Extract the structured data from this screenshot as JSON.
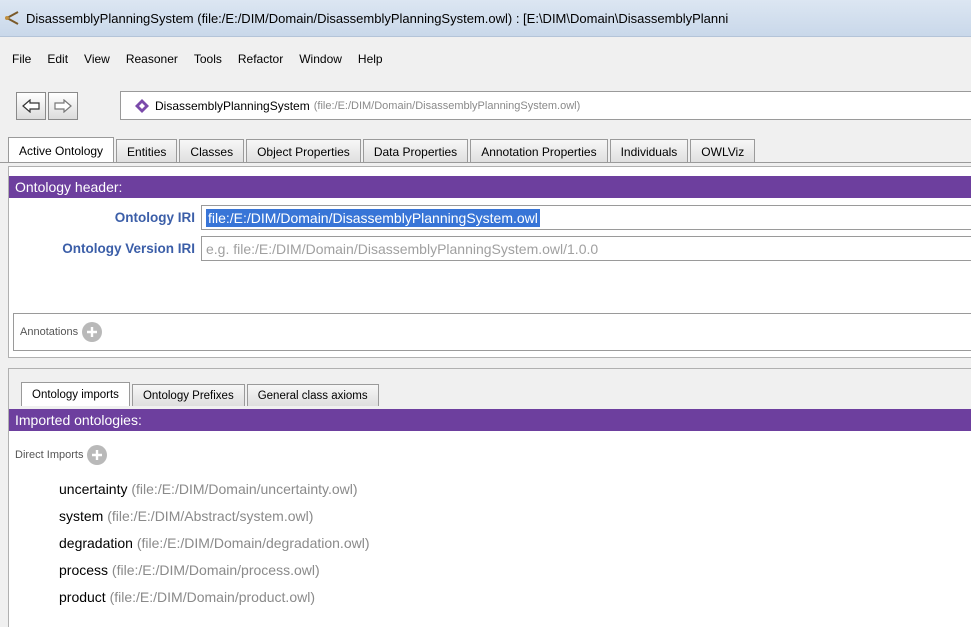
{
  "window": {
    "title": "DisassemblyPlanningSystem (file:/E:/DIM/Domain/DisassemblyPlanningSystem.owl)  : [E:\\DIM\\Domain\\DisassemblyPlanni"
  },
  "menu": [
    "File",
    "Edit",
    "View",
    "Reasoner",
    "Tools",
    "Refactor",
    "Window",
    "Help"
  ],
  "address": {
    "name": "DisassemblyPlanningSystem",
    "path": "(file:/E:/DIM/Domain/DisassemblyPlanningSystem.owl)"
  },
  "tabs": [
    "Active Ontology",
    "Entities",
    "Classes",
    "Object Properties",
    "Data Properties",
    "Annotation Properties",
    "Individuals",
    "OWLViz"
  ],
  "header": {
    "title": "Ontology header:",
    "iri_label": "Ontology IRI",
    "iri_value": "file:/E:/DIM/Domain/DisassemblyPlanningSystem.owl",
    "version_label": "Ontology Version IRI",
    "version_placeholder": "e.g. file:/E:/DIM/Domain/DisassemblyPlanningSystem.owl/1.0.0",
    "annotations_label": "Annotations"
  },
  "subtabs": [
    "Ontology imports",
    "Ontology Prefixes",
    "General class axioms"
  ],
  "imports": {
    "title": "Imported ontologies:",
    "direct_label": "Direct Imports",
    "items": [
      {
        "name": "uncertainty",
        "path": "(file:/E:/DIM/Domain/uncertainty.owl)"
      },
      {
        "name": "system",
        "path": "(file:/E:/DIM/Abstract/system.owl)"
      },
      {
        "name": "degradation",
        "path": "(file:/E:/DIM/Domain/degradation.owl)"
      },
      {
        "name": "process",
        "path": "(file:/E:/DIM/Domain/process.owl)"
      },
      {
        "name": "product",
        "path": "(file:/E:/DIM/Domain/product.owl)"
      }
    ]
  },
  "colors": {
    "accent": "#6d3f9e",
    "label": "#3b5ea8",
    "selection": "#3875d7"
  }
}
